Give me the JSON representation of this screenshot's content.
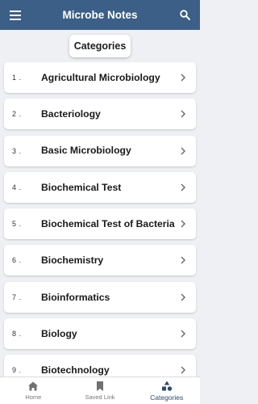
{
  "app": {
    "title": "Microbe Notes"
  },
  "chip": {
    "label": "Categories"
  },
  "colors": {
    "appbar": "#3b5f86",
    "active": "#2b4a6f"
  },
  "categories": [
    {
      "num": "1 .",
      "label": "Agricultural Microbiology"
    },
    {
      "num": "2 .",
      "label": "Bacteriology"
    },
    {
      "num": "3 .",
      "label": "Basic Microbiology"
    },
    {
      "num": "4 .",
      "label": "Biochemical Test"
    },
    {
      "num": "5 .",
      "label": "Biochemical Test of Bacteria"
    },
    {
      "num": "6 .",
      "label": "Biochemistry"
    },
    {
      "num": "7 .",
      "label": "Bioinformatics"
    },
    {
      "num": "8 .",
      "label": "Biology"
    },
    {
      "num": "9 .",
      "label": "Biotechnology"
    }
  ],
  "nav": {
    "home": {
      "label": "Home",
      "icon": "home-icon"
    },
    "saved": {
      "label": "Saved Link",
      "icon": "bookmark-icon"
    },
    "categories": {
      "label": "Categories",
      "icon": "shapes-icon"
    }
  }
}
